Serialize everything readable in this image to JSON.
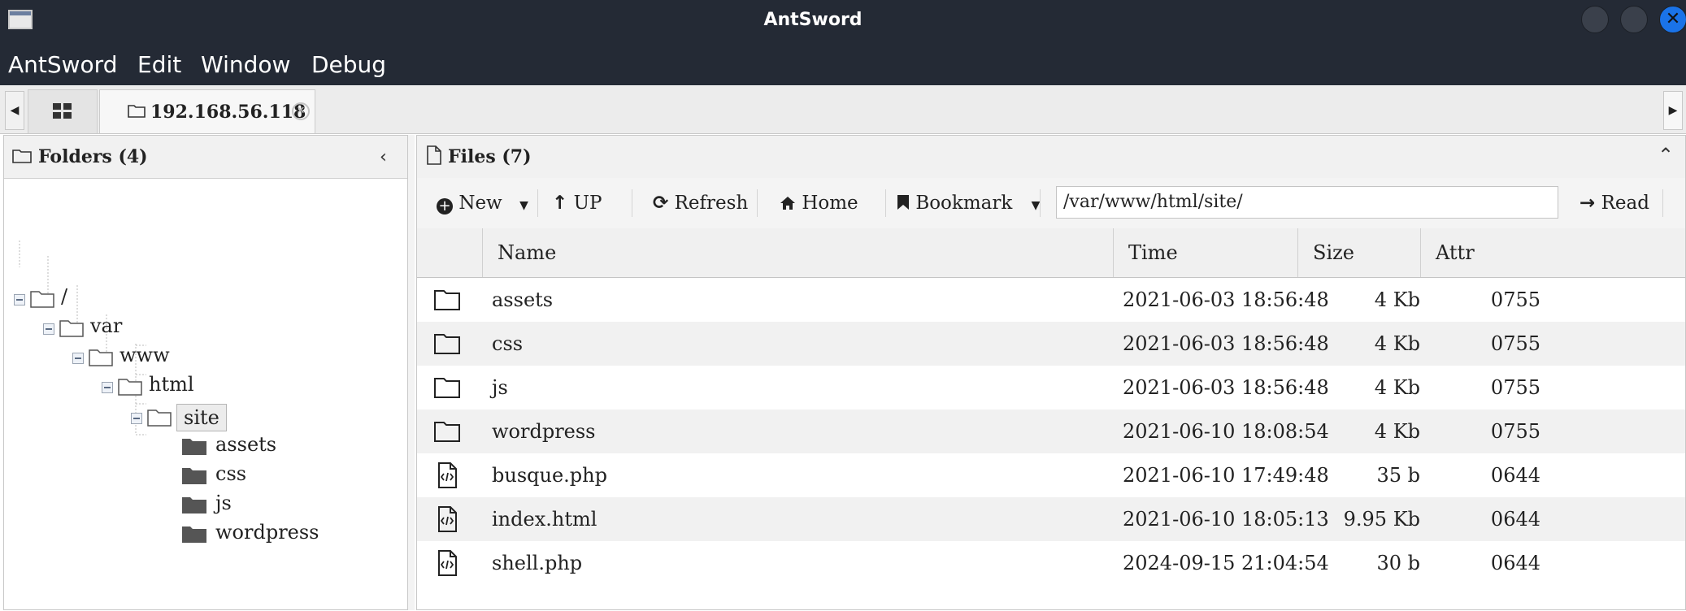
{
  "window": {
    "title": "AntSword"
  },
  "menubar": {
    "items": [
      "AntSword",
      "Edit",
      "Window",
      "Debug"
    ]
  },
  "tabs": [
    {
      "label": "",
      "icon": "grid-icon"
    },
    {
      "label": "192.168.56.118",
      "icon": "folder-icon"
    }
  ],
  "folders_panel": {
    "title": "Folders (4)",
    "tree": [
      {
        "label": "/",
        "depth": 0,
        "type": "open-folder"
      },
      {
        "label": "var",
        "depth": 1,
        "type": "open-folder"
      },
      {
        "label": "www",
        "depth": 2,
        "type": "open-folder"
      },
      {
        "label": "html",
        "depth": 3,
        "type": "open-folder"
      },
      {
        "label": "site",
        "depth": 4,
        "type": "open-folder",
        "selected": true
      },
      {
        "label": "assets",
        "depth": 5,
        "type": "folder"
      },
      {
        "label": "css",
        "depth": 5,
        "type": "folder"
      },
      {
        "label": "js",
        "depth": 5,
        "type": "folder"
      },
      {
        "label": "wordpress",
        "depth": 5,
        "type": "folder"
      }
    ]
  },
  "files_panel": {
    "title": "Files (7)",
    "toolbar": {
      "new": "New",
      "up": "UP",
      "refresh": "Refresh",
      "home": "Home",
      "bookmark": "Bookmark",
      "path": "/var/www/html/site/",
      "read": "Read"
    },
    "columns": {
      "name": "Name",
      "time": "Time",
      "size": "Size",
      "attr": "Attr"
    },
    "rows": [
      {
        "icon": "folder-icon",
        "name": "assets",
        "time": "2021-06-03 18:56:48",
        "size": "4 Kb",
        "attr": "0755"
      },
      {
        "icon": "folder-icon",
        "name": "css",
        "time": "2021-06-03 18:56:48",
        "size": "4 Kb",
        "attr": "0755"
      },
      {
        "icon": "folder-icon",
        "name": "js",
        "time": "2021-06-03 18:56:48",
        "size": "4 Kb",
        "attr": "0755"
      },
      {
        "icon": "folder-icon",
        "name": "wordpress",
        "time": "2021-06-10 18:08:54",
        "size": "4 Kb",
        "attr": "0755"
      },
      {
        "icon": "code-file-icon",
        "name": "busque.php",
        "time": "2021-06-10 17:49:48",
        "size": "35 b",
        "attr": "0644"
      },
      {
        "icon": "code-file-icon",
        "name": "index.html",
        "time": "2021-06-10 18:05:13",
        "size": "9.95 Kb",
        "attr": "0644"
      },
      {
        "icon": "code-file-icon",
        "name": "shell.php",
        "time": "2024-09-15 21:04:54",
        "size": "30 b",
        "attr": "0644"
      }
    ]
  }
}
